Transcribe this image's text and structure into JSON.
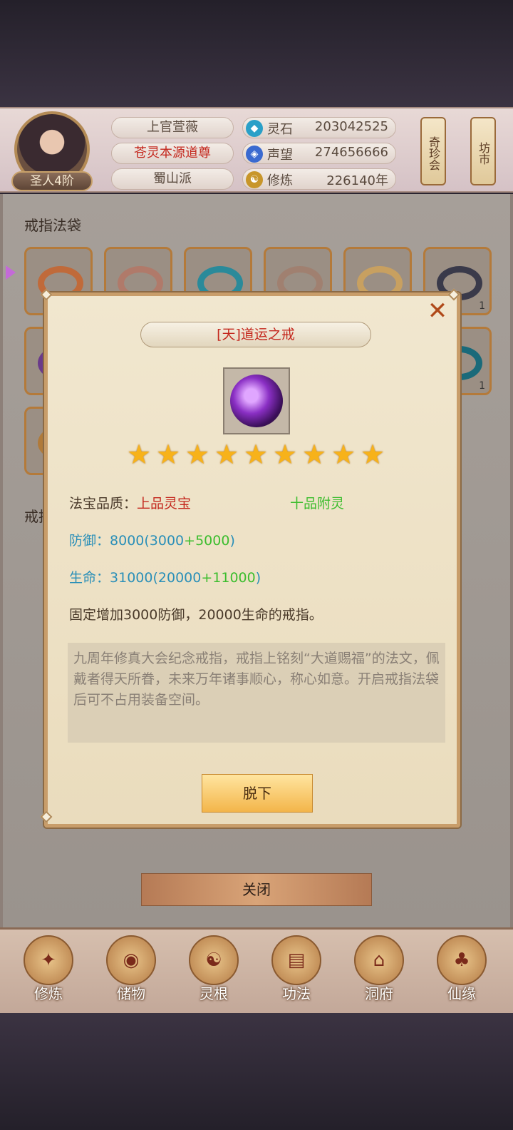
{
  "header": {
    "player_name": "上官萱薇",
    "title": "苍灵本源道尊",
    "sect": "蜀山派",
    "rank": "圣人4阶",
    "resources": [
      {
        "label": "灵石",
        "value": "203042525",
        "icon": "spirit-stone-icon",
        "color": "#2aa0c8"
      },
      {
        "label": "声望",
        "value": "274656666",
        "icon": "reputation-icon",
        "color": "#3a6ad0"
      },
      {
        "label": "修炼",
        "value": "226140年",
        "icon": "cultivation-icon",
        "color": "#c8962a"
      }
    ],
    "side_buttons": [
      "奇珍会",
      "坊市"
    ]
  },
  "panel": {
    "section_title": "戒指法袋",
    "section_title2": "戒指",
    "slot_counts": [
      "1",
      "1"
    ],
    "close_label": "关闭"
  },
  "dialog": {
    "item_name": "[天]道运之戒",
    "stars": 9,
    "quality_label": "法宝品质：",
    "quality_value": "上品灵宝",
    "enchant": "十品附灵",
    "defense_label": "防御：",
    "defense_total": "8000",
    "defense_base": "3000",
    "defense_bonus": "+5000",
    "life_label": "生命：",
    "life_total": "31000",
    "life_base": "20000",
    "life_bonus": "+11000",
    "effect": "固定增加3000防御，20000生命的戒指。",
    "description": "九周年修真大会纪念戒指，戒指上铭刻“大道赐福”的法文，佩戴者得天所眷，未来万年诸事顺心，称心如意。开启戒指法袋后可不占用装备空间。",
    "action_label": "脱下",
    "close_icon": "close-icon"
  },
  "nav": [
    {
      "label": "修炼",
      "icon": "cultivate-icon"
    },
    {
      "label": "储物",
      "icon": "storage-bag-icon"
    },
    {
      "label": "灵根",
      "icon": "spirit-root-icon"
    },
    {
      "label": "功法",
      "icon": "technique-book-icon"
    },
    {
      "label": "洞府",
      "icon": "cave-mansion-icon"
    },
    {
      "label": "仙缘",
      "icon": "fortune-gourd-icon"
    }
  ]
}
